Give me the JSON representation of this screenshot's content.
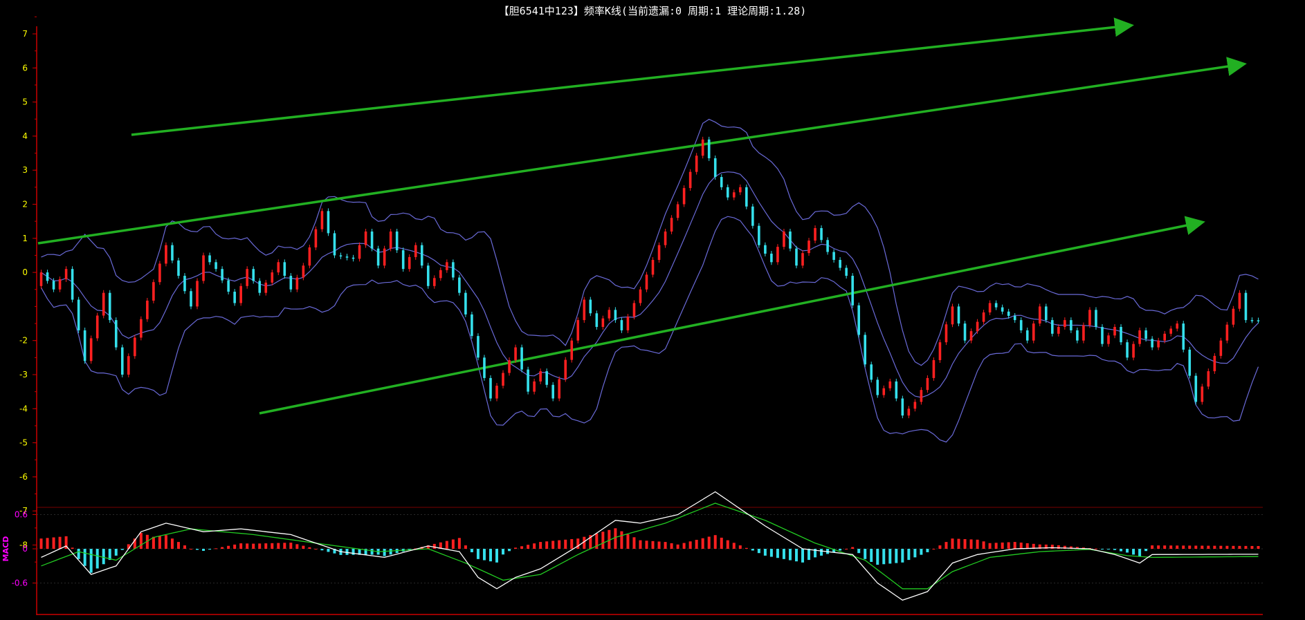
{
  "title": "【胆6541中123】频率K线(当前遗漏:0 周期:1 理论周期:1.28)",
  "colors": {
    "background": "#000000",
    "axis": "#cc0000",
    "up": "#ff2020",
    "down": "#35e0ec",
    "band": "#6a6ad8",
    "trend": "#22b022",
    "dif": "#ffffff",
    "dea": "#22cc22",
    "ytick": "#ffff00",
    "macd_label": "#ff00ff"
  },
  "chart_data": [
    {
      "type": "candlestick",
      "name": "频率K线",
      "yticks": [
        7,
        6,
        5,
        4,
        3,
        2,
        1,
        0,
        -2,
        -3,
        -4,
        -5,
        -6,
        -7,
        -8
      ],
      "ylim": [
        -8.6,
        7.5
      ],
      "bar_count": 196,
      "y_anchors": [
        [
          0,
          0
        ],
        [
          2,
          -0.5
        ],
        [
          4,
          0.1
        ],
        [
          7,
          -2.6
        ],
        [
          10,
          -0.6
        ],
        [
          13,
          -3.0
        ],
        [
          20,
          0.8
        ],
        [
          24,
          -1.0
        ],
        [
          26,
          0.5
        ],
        [
          28,
          0.1
        ],
        [
          31,
          -0.9
        ],
        [
          33,
          0.1
        ],
        [
          35,
          -0.6
        ],
        [
          38,
          0.3
        ],
        [
          40,
          -0.5
        ],
        [
          42,
          0.2
        ],
        [
          45,
          1.8
        ],
        [
          47,
          0.5
        ],
        [
          50,
          0.4
        ],
        [
          52,
          1.2
        ],
        [
          54,
          0.2
        ],
        [
          56,
          1.2
        ],
        [
          58,
          0.1
        ],
        [
          60,
          0.8
        ],
        [
          62,
          -0.4
        ],
        [
          65,
          0.3
        ],
        [
          67,
          -0.6
        ],
        [
          70,
          -2.5
        ],
        [
          72,
          -3.7
        ],
        [
          76,
          -2.2
        ],
        [
          78,
          -3.5
        ],
        [
          80,
          -2.9
        ],
        [
          82,
          -3.7
        ],
        [
          85,
          -2.0
        ],
        [
          87,
          -0.8
        ],
        [
          89,
          -1.6
        ],
        [
          91,
          -1.1
        ],
        [
          93,
          -1.7
        ],
        [
          96,
          -0.5
        ],
        [
          99,
          0.8
        ],
        [
          102,
          2.0
        ],
        [
          106,
          3.9
        ],
        [
          108,
          2.8
        ],
        [
          110,
          2.2
        ],
        [
          112,
          2.5
        ],
        [
          115,
          0.8
        ],
        [
          117,
          0.3
        ],
        [
          119,
          1.2
        ],
        [
          121,
          0.2
        ],
        [
          124,
          1.3
        ],
        [
          126,
          0.6
        ],
        [
          129,
          -0.1
        ],
        [
          132,
          -2.7
        ],
        [
          134,
          -3.6
        ],
        [
          136,
          -3.2
        ],
        [
          138,
          -4.2
        ],
        [
          140,
          -3.8
        ],
        [
          142,
          -3.1
        ],
        [
          146,
          -1.0
        ],
        [
          148,
          -2.0
        ],
        [
          152,
          -0.9
        ],
        [
          156,
          -1.4
        ],
        [
          158,
          -2.0
        ],
        [
          160,
          -1.0
        ],
        [
          162,
          -1.8
        ],
        [
          164,
          -1.4
        ],
        [
          166,
          -2.0
        ],
        [
          168,
          -1.1
        ],
        [
          170,
          -2.1
        ],
        [
          172,
          -1.6
        ],
        [
          174,
          -2.5
        ],
        [
          176,
          -1.7
        ],
        [
          178,
          -2.2
        ],
        [
          180,
          -1.8
        ],
        [
          182,
          -1.5
        ],
        [
          185,
          -3.8
        ],
        [
          189,
          -2.0
        ],
        [
          192,
          -0.6
        ],
        [
          193,
          -1.4
        ]
      ]
    },
    {
      "type": "line",
      "name": "MACD",
      "label": "MACD",
      "yticks": [
        0.6,
        0,
        -0.6
      ],
      "ylim": [
        -0.95,
        1.05
      ],
      "dif_anchors": [
        [
          0,
          -0.15
        ],
        [
          4,
          0.05
        ],
        [
          8,
          -0.45
        ],
        [
          12,
          -0.3
        ],
        [
          16,
          0.3
        ],
        [
          20,
          0.45
        ],
        [
          26,
          0.3
        ],
        [
          32,
          0.35
        ],
        [
          40,
          0.25
        ],
        [
          48,
          -0.05
        ],
        [
          55,
          -0.15
        ],
        [
          62,
          0.05
        ],
        [
          67,
          -0.05
        ],
        [
          70,
          -0.5
        ],
        [
          73,
          -0.7
        ],
        [
          76,
          -0.5
        ],
        [
          80,
          -0.35
        ],
        [
          86,
          0.05
        ],
        [
          92,
          0.5
        ],
        [
          96,
          0.45
        ],
        [
          102,
          0.6
        ],
        [
          108,
          1.0
        ],
        [
          116,
          0.4
        ],
        [
          122,
          0.0
        ],
        [
          130,
          -0.1
        ],
        [
          134,
          -0.6
        ],
        [
          138,
          -0.9
        ],
        [
          142,
          -0.75
        ],
        [
          146,
          -0.25
        ],
        [
          150,
          -0.1
        ],
        [
          156,
          0.0
        ],
        [
          162,
          0.02
        ],
        [
          168,
          0.0
        ],
        [
          172,
          -0.1
        ],
        [
          176,
          -0.25
        ],
        [
          178,
          -0.1
        ]
      ],
      "dea_anchors": [
        [
          0,
          -0.3
        ],
        [
          6,
          -0.05
        ],
        [
          12,
          -0.2
        ],
        [
          18,
          0.2
        ],
        [
          24,
          0.35
        ],
        [
          34,
          0.25
        ],
        [
          44,
          0.1
        ],
        [
          54,
          -0.05
        ],
        [
          62,
          0.0
        ],
        [
          68,
          -0.25
        ],
        [
          74,
          -0.55
        ],
        [
          80,
          -0.45
        ],
        [
          86,
          -0.1
        ],
        [
          92,
          0.2
        ],
        [
          100,
          0.45
        ],
        [
          108,
          0.8
        ],
        [
          116,
          0.5
        ],
        [
          124,
          0.1
        ],
        [
          132,
          -0.2
        ],
        [
          138,
          -0.7
        ],
        [
          142,
          -0.7
        ],
        [
          146,
          -0.4
        ],
        [
          152,
          -0.15
        ],
        [
          160,
          -0.05
        ],
        [
          168,
          -0.01
        ],
        [
          174,
          -0.12
        ],
        [
          178,
          -0.15
        ]
      ]
    }
  ]
}
